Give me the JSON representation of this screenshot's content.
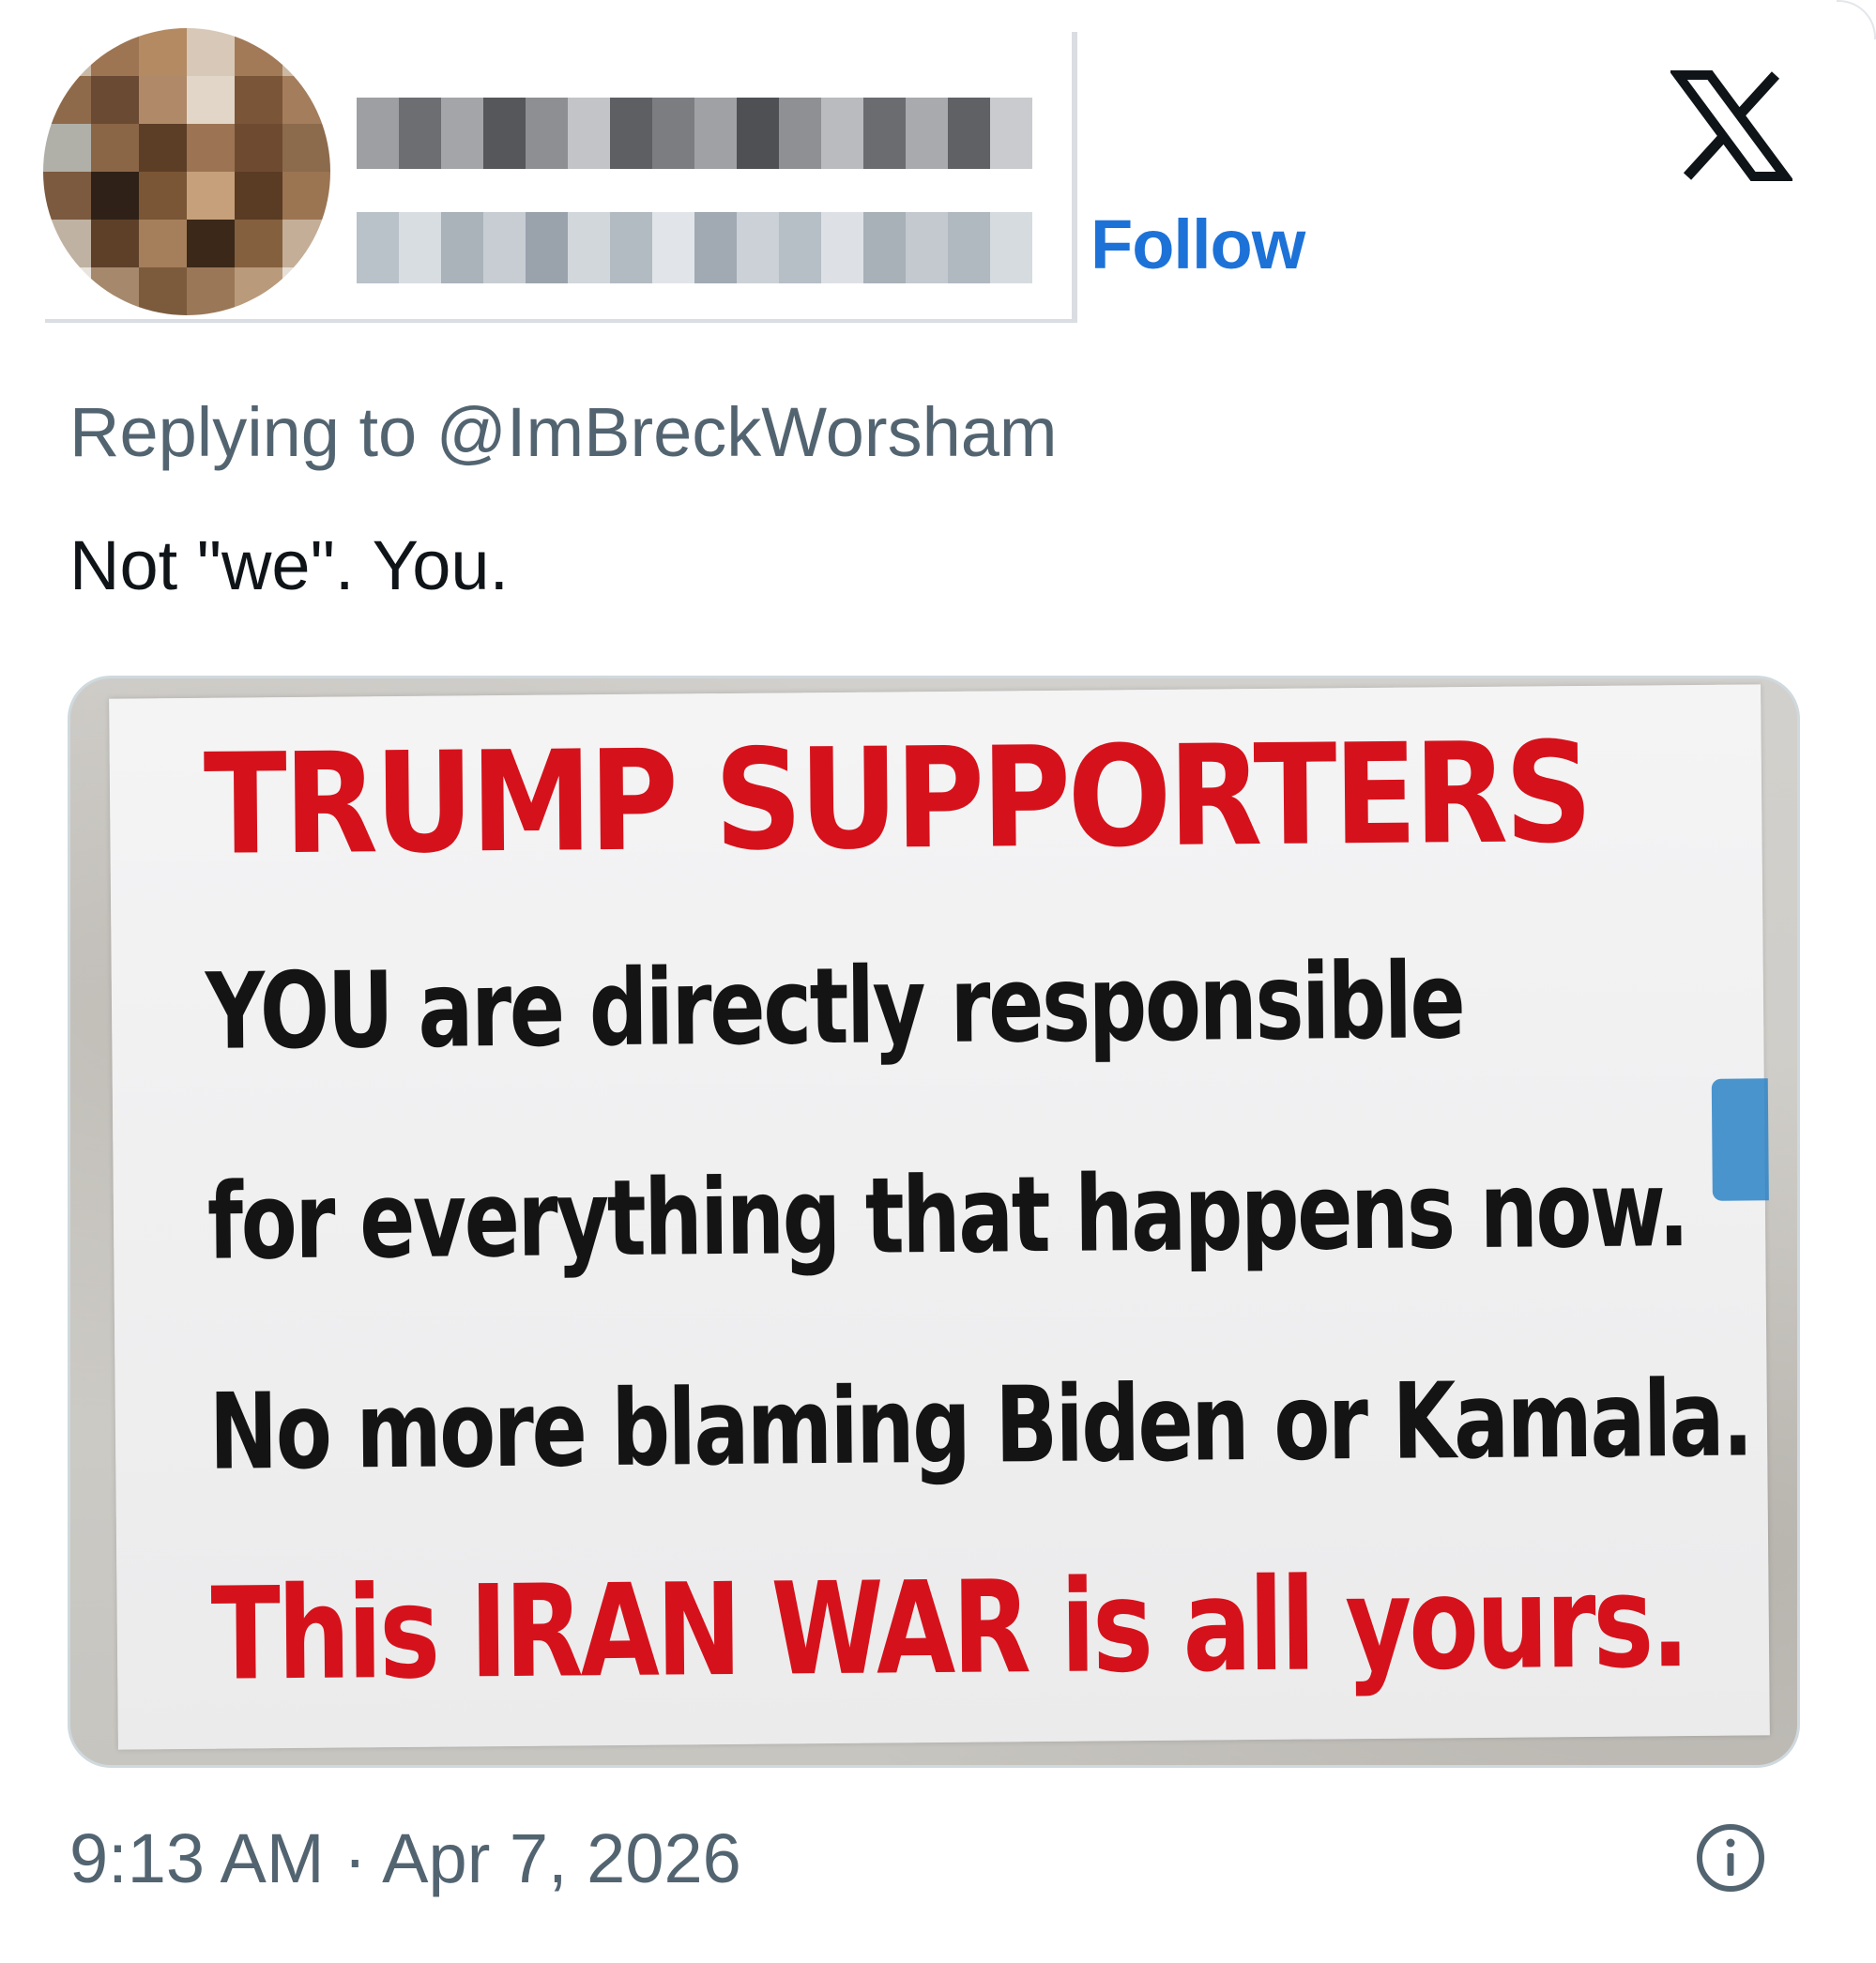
{
  "header": {
    "follow_label": "Follow",
    "logo_icon": "x-logo-icon"
  },
  "reply": {
    "prefix": "Replying to ",
    "handle": "@ImBreckWorsham"
  },
  "tweet": {
    "text": "Not \"we\". You."
  },
  "media": {
    "sign_lines": [
      "TRUMP SUPPORTERS",
      "YOU are directly responsible",
      "for everything that happens now.",
      "No more blaming Biden or Kamala.",
      "This IRAN WAR is all yours."
    ]
  },
  "footer": {
    "timestamp": "9:13 AM · Apr 7, 2026",
    "info_icon": "info-icon"
  },
  "colors": {
    "follow_link": "#1d72d8",
    "secondary_text": "#536471",
    "primary_text": "#0f1419",
    "sign_red": "#d5121b",
    "sign_black": "#141414"
  }
}
